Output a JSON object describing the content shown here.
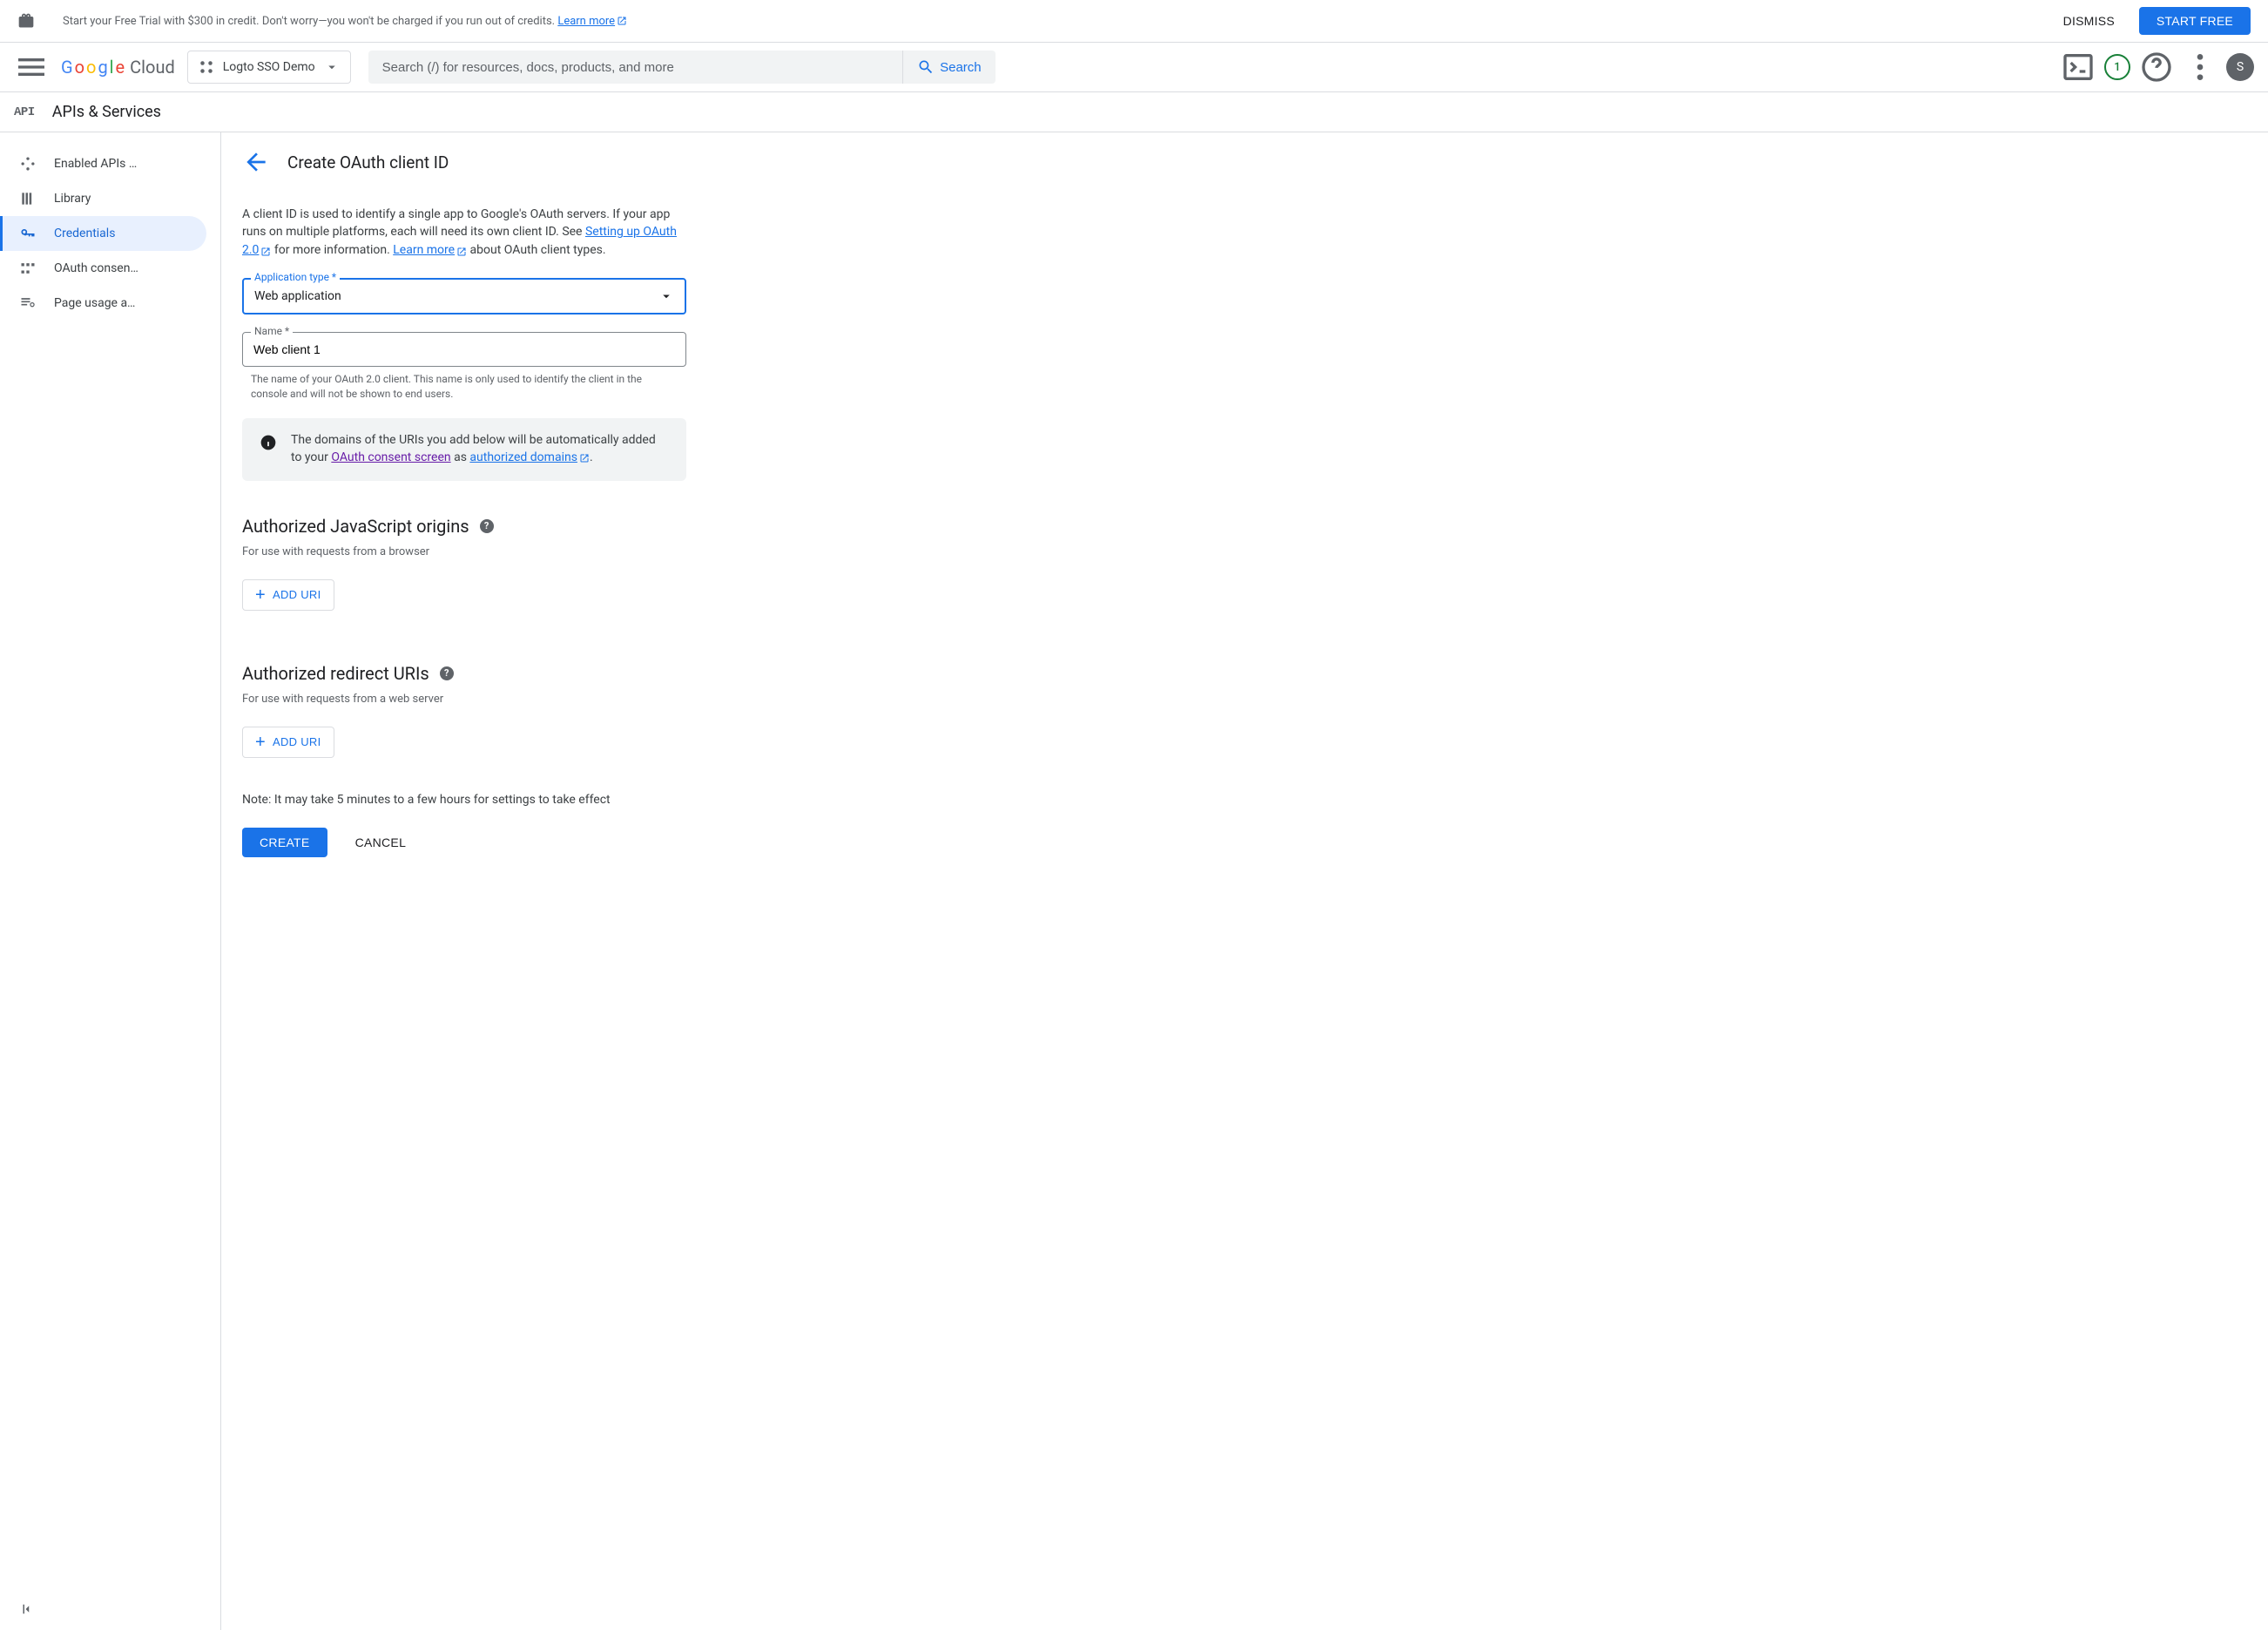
{
  "banner": {
    "text_prefix": "Start your Free Trial with $300 in credit. Don't worry—you won't be charged if you run out of credits. ",
    "learn_more": "Learn more",
    "dismiss": "DISMISS",
    "start_free": "START FREE"
  },
  "header": {
    "logo_google": "Google",
    "logo_cloud": "Cloud",
    "project_name": "Logto SSO Demo",
    "search_placeholder": "Search (/) for resources, docs, products, and more",
    "search_label": "Search",
    "notification_count": "1",
    "avatar_initial": "S"
  },
  "subheader": {
    "api_badge": "API",
    "section_title": "APIs & Services"
  },
  "sidebar": {
    "items": [
      {
        "label": "Enabled APIs …",
        "icon": "grid"
      },
      {
        "label": "Library",
        "icon": "library"
      },
      {
        "label": "Credentials",
        "icon": "key"
      },
      {
        "label": "OAuth consen…",
        "icon": "consent"
      },
      {
        "label": "Page usage a…",
        "icon": "page"
      }
    ]
  },
  "page": {
    "title": "Create OAuth client ID",
    "intro_p1": "A client ID is used to identify a single app to Google's OAuth servers. If your app runs on multiple platforms, each will need its own client ID. See ",
    "intro_link1": "Setting up OAuth 2.0",
    "intro_p2": " for more information. ",
    "intro_link2": "Learn more",
    "intro_p3": " about OAuth client types."
  },
  "form": {
    "app_type_label": "Application type *",
    "app_type_value": "Web application",
    "name_label": "Name *",
    "name_value": "Web client 1",
    "name_helper": "The name of your OAuth 2.0 client. This name is only used to identify the client in the console and will not be shown to end users."
  },
  "info": {
    "text_p1": "The domains of the URIs you add below will be automatically added to your ",
    "link1": "OAuth consent screen",
    "text_p2": " as ",
    "link2": "authorized domains",
    "text_p3": "."
  },
  "section_js": {
    "heading": "Authorized JavaScript origins",
    "desc": "For use with requests from a browser",
    "add_btn": "ADD URI"
  },
  "section_redirect": {
    "heading": "Authorized redirect URIs",
    "desc": "For use with requests from a web server",
    "add_btn": "ADD URI"
  },
  "footer": {
    "note": "Note: It may take 5 minutes to a few hours for settings to take effect",
    "create": "CREATE",
    "cancel": "CANCEL"
  }
}
